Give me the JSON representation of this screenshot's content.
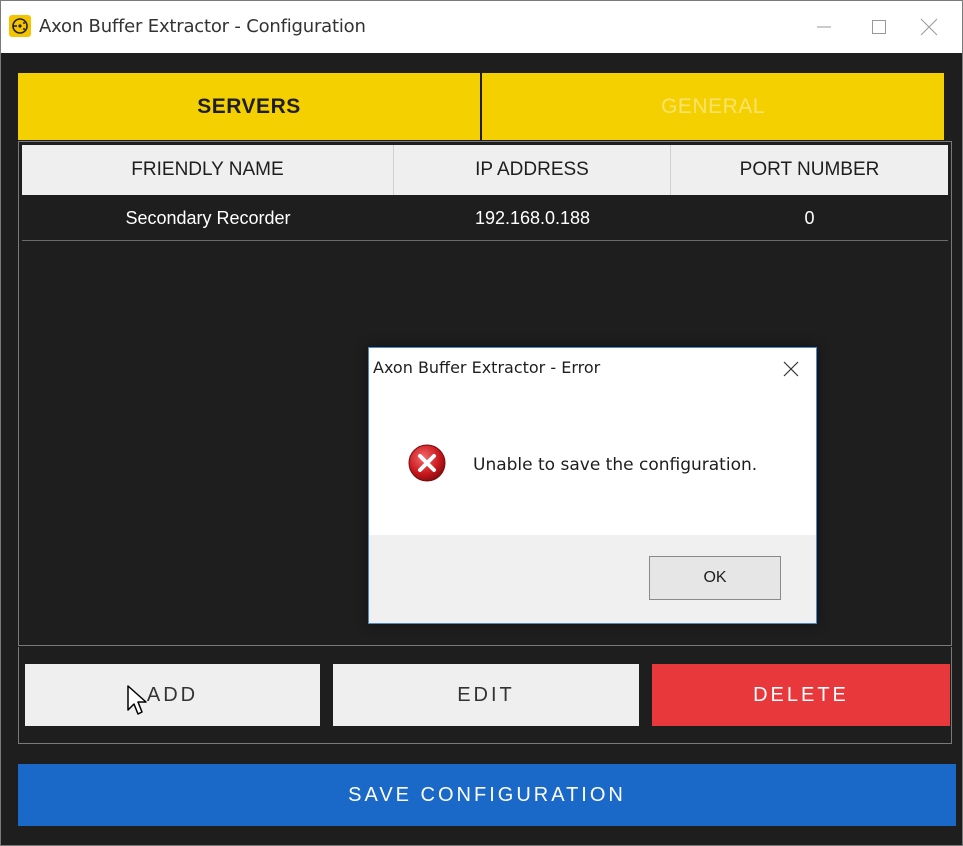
{
  "window": {
    "title": "Axon Buffer Extractor - Configuration",
    "icon": "app-logo-icon"
  },
  "tabs": [
    {
      "label": "SERVERS",
      "active": true
    },
    {
      "label": "GENERAL",
      "active": false
    }
  ],
  "grid": {
    "columns": [
      "FRIENDLY NAME",
      "IP ADDRESS",
      "PORT NUMBER"
    ],
    "rows": [
      {
        "friendly_name": "Secondary Recorder",
        "ip_address": "192.168.0.188",
        "port_number": "0"
      }
    ]
  },
  "actions": {
    "add": "ADD",
    "edit": "EDIT",
    "delete": "DELETE",
    "save": "SAVE CONFIGURATION"
  },
  "dialog": {
    "title": "Axon Buffer Extractor - Error",
    "message": "Unable to save the configuration.",
    "ok": "OK",
    "icon": "error-icon"
  },
  "colors": {
    "tab_yellow": "#f5d000",
    "delete_red": "#e8383c",
    "save_blue": "#1a68c8",
    "background": "#1e1e1e"
  }
}
